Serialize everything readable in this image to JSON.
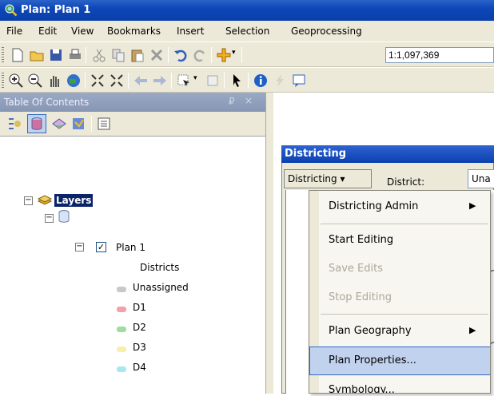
{
  "window": {
    "title": "Plan: Plan 1",
    "icon": "globe-magnifier-icon"
  },
  "menu": [
    "File",
    "Edit",
    "View",
    "Bookmarks",
    "Insert",
    "Selection",
    "Geoprocessing"
  ],
  "toolbar": {
    "scale": "1:1,097,369"
  },
  "toc": {
    "title": "Table Of Contents",
    "pin": "₽",
    "close": "×",
    "tree": {
      "root_label": "Layers",
      "plan_label": "Plan 1",
      "group_label": "Districts",
      "items": [
        {
          "label": "Unassigned",
          "color": "#c8c8c8"
        },
        {
          "label": "D1",
          "color": "#f4a0a8"
        },
        {
          "label": "D2",
          "color": "#a0dca0"
        },
        {
          "label": "D3",
          "color": "#f6f0a8"
        },
        {
          "label": "D4",
          "color": "#a8e6f0"
        }
      ]
    }
  },
  "districting": {
    "title": "Districting",
    "dropdown": "Districting ▾",
    "district_label": "District:",
    "district_value": "Una"
  },
  "dropdown_menu": {
    "items": [
      {
        "label": "Districting Admin",
        "submenu": true,
        "disabled": false
      },
      {
        "label": "Start Editing",
        "submenu": false,
        "disabled": false
      },
      {
        "label": "Save Edits",
        "submenu": false,
        "disabled": true
      },
      {
        "label": "Stop Editing",
        "submenu": false,
        "disabled": true
      },
      {
        "label": "Plan Geography",
        "submenu": true,
        "disabled": false
      },
      {
        "label": "Plan Properties...",
        "submenu": false,
        "disabled": false,
        "highlighted": true
      },
      {
        "label": "Symbology...",
        "submenu": false,
        "disabled": false
      }
    ]
  }
}
